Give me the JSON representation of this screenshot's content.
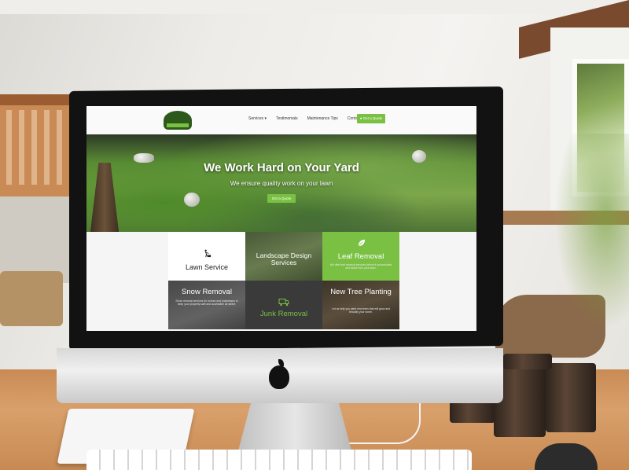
{
  "website": {
    "nav": {
      "items": [
        "Services ▾",
        "Testimonials",
        "Maintenance Tips",
        "Contact Us"
      ],
      "quote_button": "● Get a Quote"
    },
    "hero": {
      "title": "We Work Hard on Your Yard",
      "subtitle": "We ensure quality work on your lawn",
      "button": "Get a Quote"
    },
    "services": [
      {
        "title": "Lawn Service",
        "icon": "lawn-mower-icon"
      },
      {
        "title": "Landscape Design Services"
      },
      {
        "title": "Leaf Removal",
        "icon": "leaf-icon",
        "description": "We offer leaf removal services before it accumulates and fades from your lawn."
      },
      {
        "title": "Snow Removal",
        "description": "Snow removal services for homes and businesses to keep your property safe and accessible all winter."
      },
      {
        "title": "Junk Removal",
        "icon": "truck-icon"
      },
      {
        "title": "New Tree Planting",
        "description": "Let us help you plant new trees that will grow and beautify your home."
      }
    ]
  },
  "colors": {
    "brand_green": "#7ac143",
    "dark_tile": "#3a3a3a",
    "bezel": "#121212"
  }
}
